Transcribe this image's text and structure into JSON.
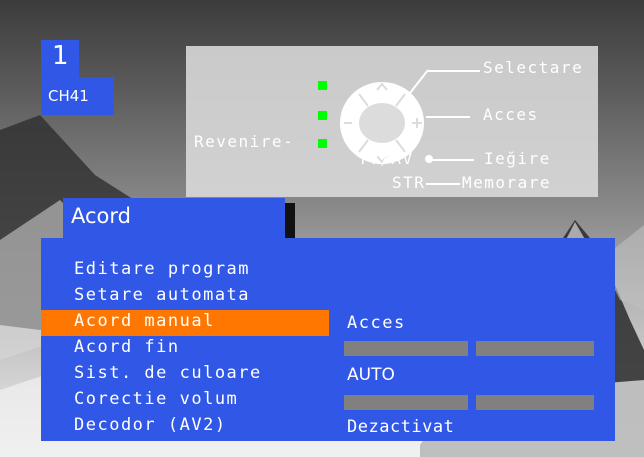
{
  "channel": {
    "number": "1",
    "name": "CH41"
  },
  "help": {
    "select_label": "Selectare",
    "access_label": "Acces",
    "back_label": "Revenire-",
    "tv_av_label": "TV/AV",
    "exit_label": "Ieğire",
    "str_label": "STR",
    "store_label": "Memorare"
  },
  "menu": {
    "title": "Acord",
    "items": [
      {
        "label": "Editare program",
        "value": "",
        "selected": false
      },
      {
        "label": "Setare automata",
        "value": "",
        "selected": false
      },
      {
        "label": "Acord manual",
        "value": "Acces",
        "selected": true
      },
      {
        "label": "Acord fin",
        "value": "",
        "control": "bar",
        "selected": false
      },
      {
        "label": "Sist. de culoare",
        "value": "AUTO",
        "selected": false
      },
      {
        "label": "Corectie volum",
        "value": "",
        "control": "bar",
        "selected": false
      },
      {
        "label": "Decodor (AV2)",
        "value": "Dezactivat",
        "selected": false
      }
    ]
  },
  "colors": {
    "menu_blue": "#3057e6",
    "highlight_orange": "#ff7700",
    "indicator_green": "#00ff00",
    "bar_gray": "#808080"
  }
}
